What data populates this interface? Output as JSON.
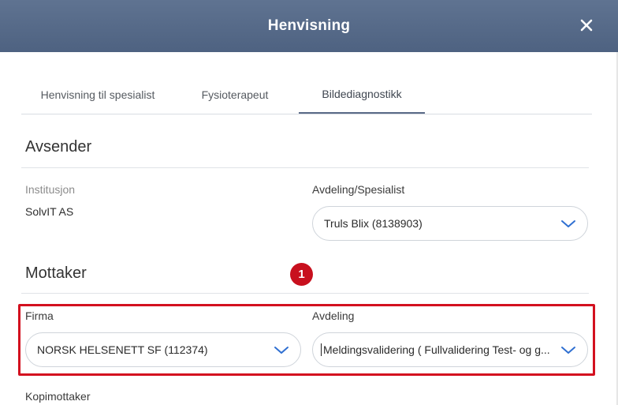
{
  "dialog": {
    "title": "Henvisning",
    "close_icon": "close-icon"
  },
  "tabs": [
    {
      "label": "Henvisning til spesialist",
      "active": false
    },
    {
      "label": "Fysioterapeut",
      "active": false
    },
    {
      "label": "Bildediagnostikk",
      "active": true
    }
  ],
  "avsender": {
    "heading": "Avsender",
    "institusjon_label": "Institusjon",
    "institusjon_value": "SolvIT AS",
    "avdeling_label": "Avdeling/Spesialist",
    "avdeling_value": "Truls Blix (8138903)"
  },
  "mottaker": {
    "heading": "Mottaker",
    "firma_label": "Firma",
    "firma_value": "NORSK HELSENETT SF (112374)",
    "avdeling_label": "Avdeling",
    "avdeling_value": "Meldingsvalidering ( Fullvalidering Test- og g..."
  },
  "kopimottaker_label": "Kopimottaker",
  "annotation": {
    "badge_number": "1",
    "highlight_color": "#d3101f"
  },
  "colors": {
    "header": "#566a89",
    "accent_chevron": "#2f6fd1",
    "active_tab_underline": "#5a6b87"
  }
}
